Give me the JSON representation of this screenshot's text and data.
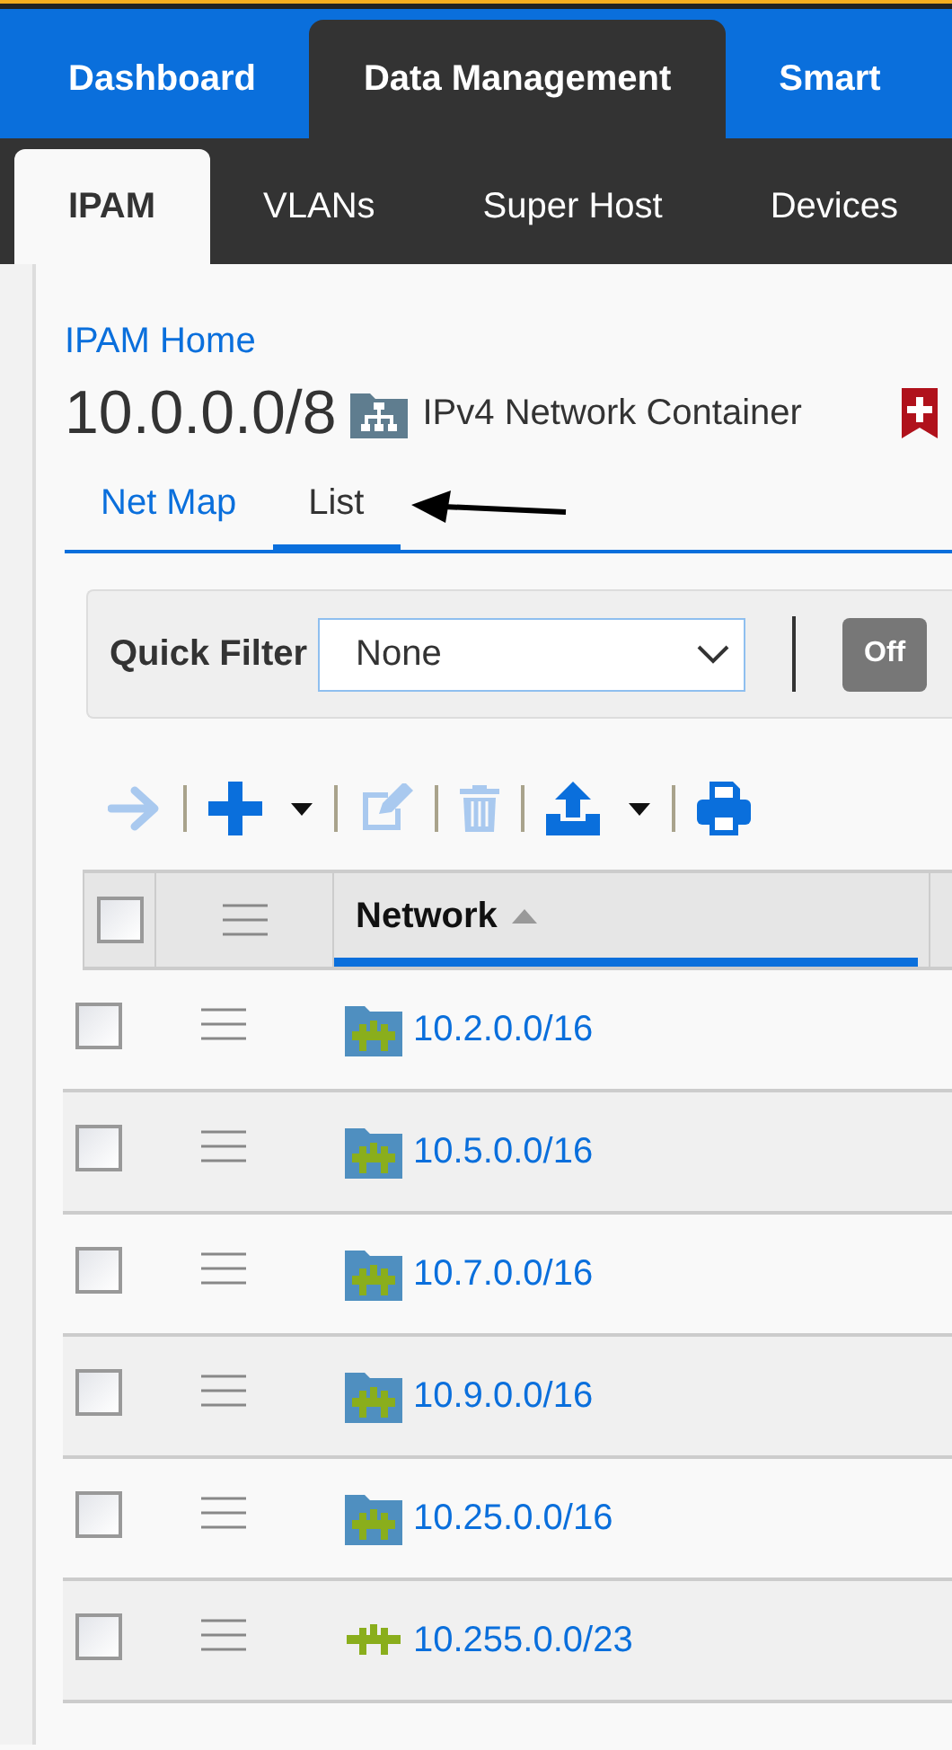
{
  "main_nav": [
    {
      "label": "Dashboard",
      "selected": false
    },
    {
      "label": "Data Management",
      "selected": true
    },
    {
      "label": "Smart",
      "selected": false
    }
  ],
  "sub_nav": [
    {
      "label": "IPAM",
      "selected": true
    },
    {
      "label": "VLANs",
      "selected": false
    },
    {
      "label": "Super Host",
      "selected": false
    },
    {
      "label": "Devices",
      "selected": false
    }
  ],
  "breadcrumb": "IPAM Home",
  "title": "10.0.0.0/8",
  "object_type": "IPv4 Network Container",
  "view_tabs": [
    {
      "label": "Net Map",
      "selected": false
    },
    {
      "label": "List",
      "selected": true
    }
  ],
  "quick_filter": {
    "label": "Quick Filter",
    "value": "None",
    "toggle": "Off"
  },
  "toolbar": [
    {
      "kind": "open",
      "disabled": true
    },
    {
      "kind": "add",
      "disabled": false,
      "menu": true
    },
    {
      "kind": "edit",
      "disabled": true
    },
    {
      "kind": "delete",
      "disabled": true
    },
    {
      "kind": "export",
      "disabled": false,
      "menu": true
    },
    {
      "kind": "print",
      "disabled": false
    }
  ],
  "table": {
    "select_all_checked": false,
    "columns": [
      {
        "label": "Network",
        "sorted": true
      }
    ],
    "rows": [
      {
        "network": "10.2.0.0/16",
        "kind": "container",
        "checked": false
      },
      {
        "network": "10.5.0.0/16",
        "kind": "container",
        "checked": false
      },
      {
        "network": "10.7.0.0/16",
        "kind": "container",
        "checked": false
      },
      {
        "network": "10.9.0.0/16",
        "kind": "container",
        "checked": false
      },
      {
        "network": "10.25.0.0/16",
        "kind": "container",
        "checked": false
      },
      {
        "network": "10.255.0.0/23",
        "kind": "network",
        "checked": false
      }
    ]
  }
}
